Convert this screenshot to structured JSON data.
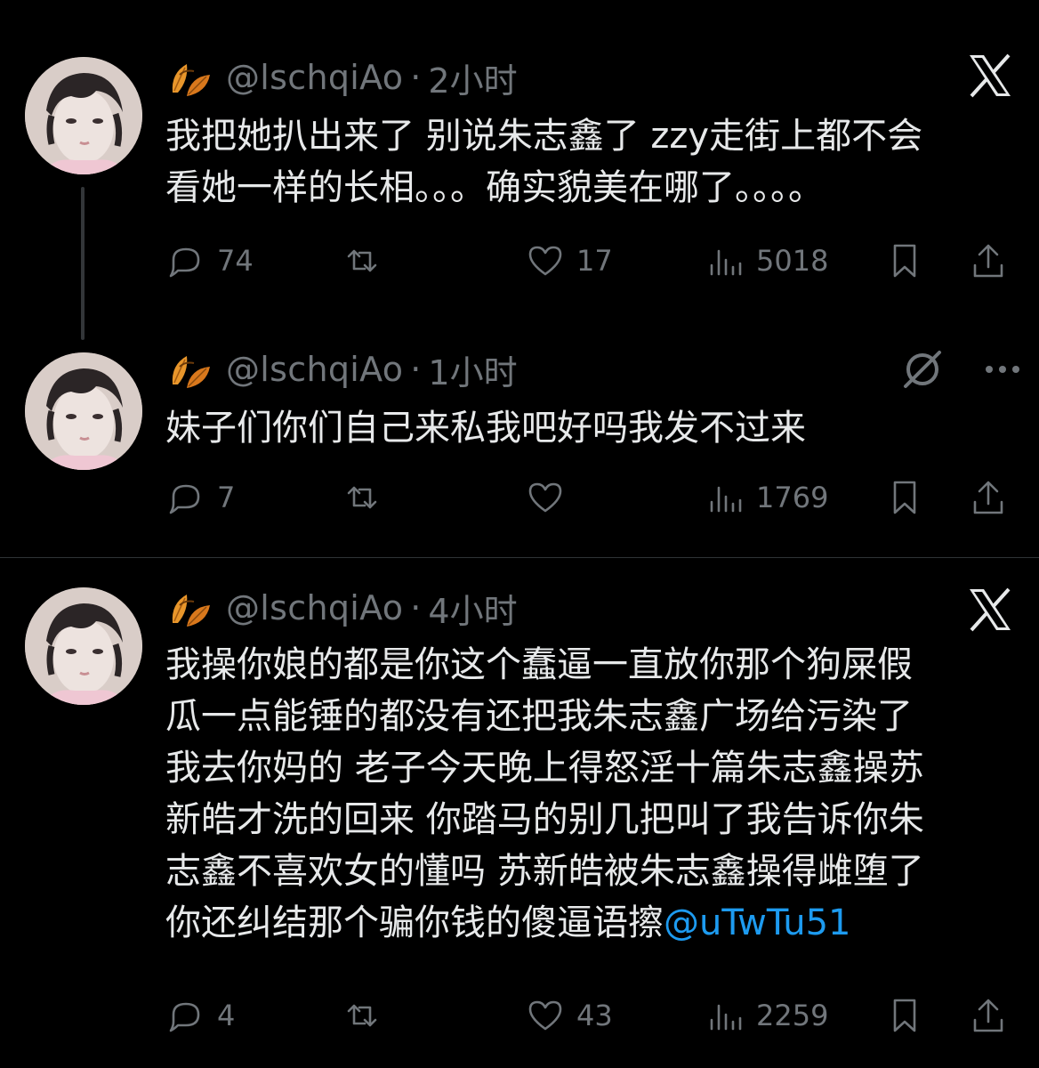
{
  "colors": {
    "background": "#000000",
    "text": "#e7e9ea",
    "muted": "#71767b",
    "mention": "#1d9bf0",
    "divider": "#2f3336"
  },
  "tweets": [
    {
      "handle": "@lschqiAo",
      "separator": "·",
      "time": "2小时",
      "lines": [
        "我把她扒出来了 别说朱志鑫了 zzy走街上都不会",
        "看她一样的长相。。。确实貌美在哪了。。。。"
      ],
      "replies": "74",
      "retweets": "",
      "likes": "17",
      "views": "5018",
      "header_icon": "grok-x-icon"
    },
    {
      "handle": "@lschqiAo",
      "separator": "·",
      "time": "1小时",
      "lines": [
        "妹子们你们自己来私我吧好吗我发不过来"
      ],
      "replies": "7",
      "retweets": "",
      "likes": "",
      "views": "1769",
      "header_icon": "grok-icon"
    },
    {
      "handle": "@lschqiAo",
      "separator": "·",
      "time": "4小时",
      "lines": [
        "我操你娘的都是你这个蠢逼一直放你那个狗屎假",
        "瓜一点能锤的都没有还把我朱志鑫广场给污染了",
        "我去你妈的 老子今天晚上得怒淫十篇朱志鑫操苏",
        "新皓才洗的回来 你踏马的别几把叫了我告诉你朱",
        "志鑫不喜欢女的懂吗 苏新皓被朱志鑫操得雌堕了",
        "你还纠结那个骗你钱的傻逼语擦"
      ],
      "mention": "@uTwTu51",
      "replies": "4",
      "retweets": "",
      "likes": "43",
      "views": "2259",
      "header_icon": "grok-x-icon"
    }
  ]
}
